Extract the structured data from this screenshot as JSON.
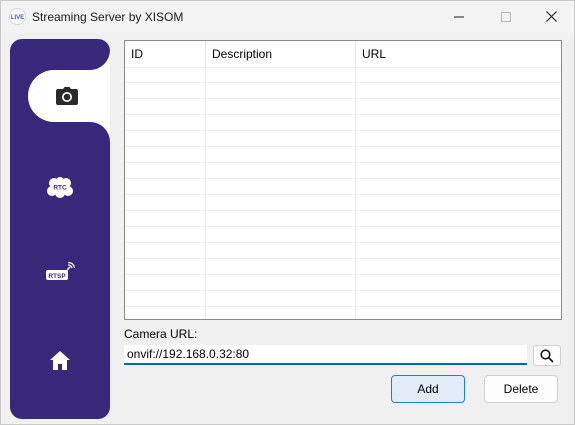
{
  "window": {
    "title": "Streaming Server by XISOM",
    "icon_text": "LIVE",
    "minimize_icon": "minimize-icon",
    "maximize_icon": "maximize-icon",
    "close_icon": "close-icon"
  },
  "sidebar": {
    "background": "#38287a",
    "items": [
      {
        "name": "camera",
        "icon": "camera-icon",
        "active": true
      },
      {
        "name": "rtc",
        "icon": "rtc-icon",
        "label": "RTC",
        "active": false
      },
      {
        "name": "rtsp",
        "icon": "rtsp-icon",
        "label": "RTSP",
        "active": false
      },
      {
        "name": "home",
        "icon": "home-icon",
        "active": false
      }
    ]
  },
  "grid": {
    "columns": [
      "ID",
      "Description",
      "URL"
    ],
    "rows": []
  },
  "camera": {
    "label": "Camera URL:",
    "value": "onvif://192.168.0.32:80",
    "search_icon": "search-icon"
  },
  "buttons": {
    "add": "Add",
    "delete": "Delete"
  },
  "colors": {
    "accent": "#0067c0",
    "sidebar": "#38287a"
  }
}
